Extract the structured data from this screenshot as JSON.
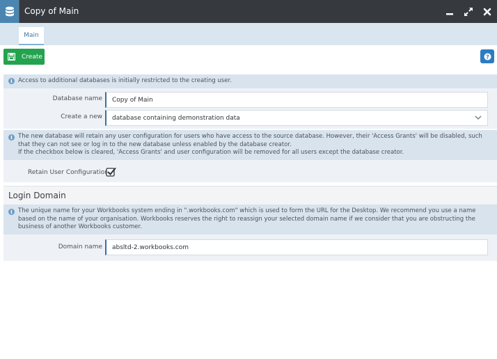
{
  "window": {
    "title": "Copy of Main",
    "icon": "database-icon",
    "controls": [
      "minimize-icon",
      "maximize-icon",
      "close-icon"
    ],
    "accent": "#36393e"
  },
  "tabs": [
    {
      "label": "Main",
      "active": true
    }
  ],
  "toolbar": {
    "create_label": "Create",
    "create_color": "#23a34e",
    "help_icon": "help-icon"
  },
  "notice1": "Access to additional databases is initially restricted to the creating user.",
  "form": {
    "database_name_label": "Database name",
    "database_name_value": "Copy of Main",
    "create_new_label": "Create a new",
    "create_new_value": "database containing demonstration data"
  },
  "notice2": {
    "line1": "The new database will retain any user configuration for users who have access to the source database. However, their 'Access Grants' will be disabled, such",
    "line2": "that they can not see or log in to the new database unless enabled by the database creator.",
    "line3": "If the checkbox below is cleared, 'Access Grants' and user configuration will be removed for all users except the database creator."
  },
  "retain": {
    "label": "Retain User Configuration",
    "checked": true
  },
  "login_domain": {
    "heading": "Login Domain",
    "info_line1": "The unique name for your Workbooks system ending in \".workbooks.com\" which is used to form the URL for the Desktop. We recommend you use a name",
    "info_line2": "based on the name of your organisation. Workbooks reserves the right to reassign your selected domain name if we consider that you are obstructing the",
    "info_line3": "business of another Workbooks customer.",
    "domain_label": "Domain name",
    "domain_value": "absltd-2.workbooks.com"
  }
}
